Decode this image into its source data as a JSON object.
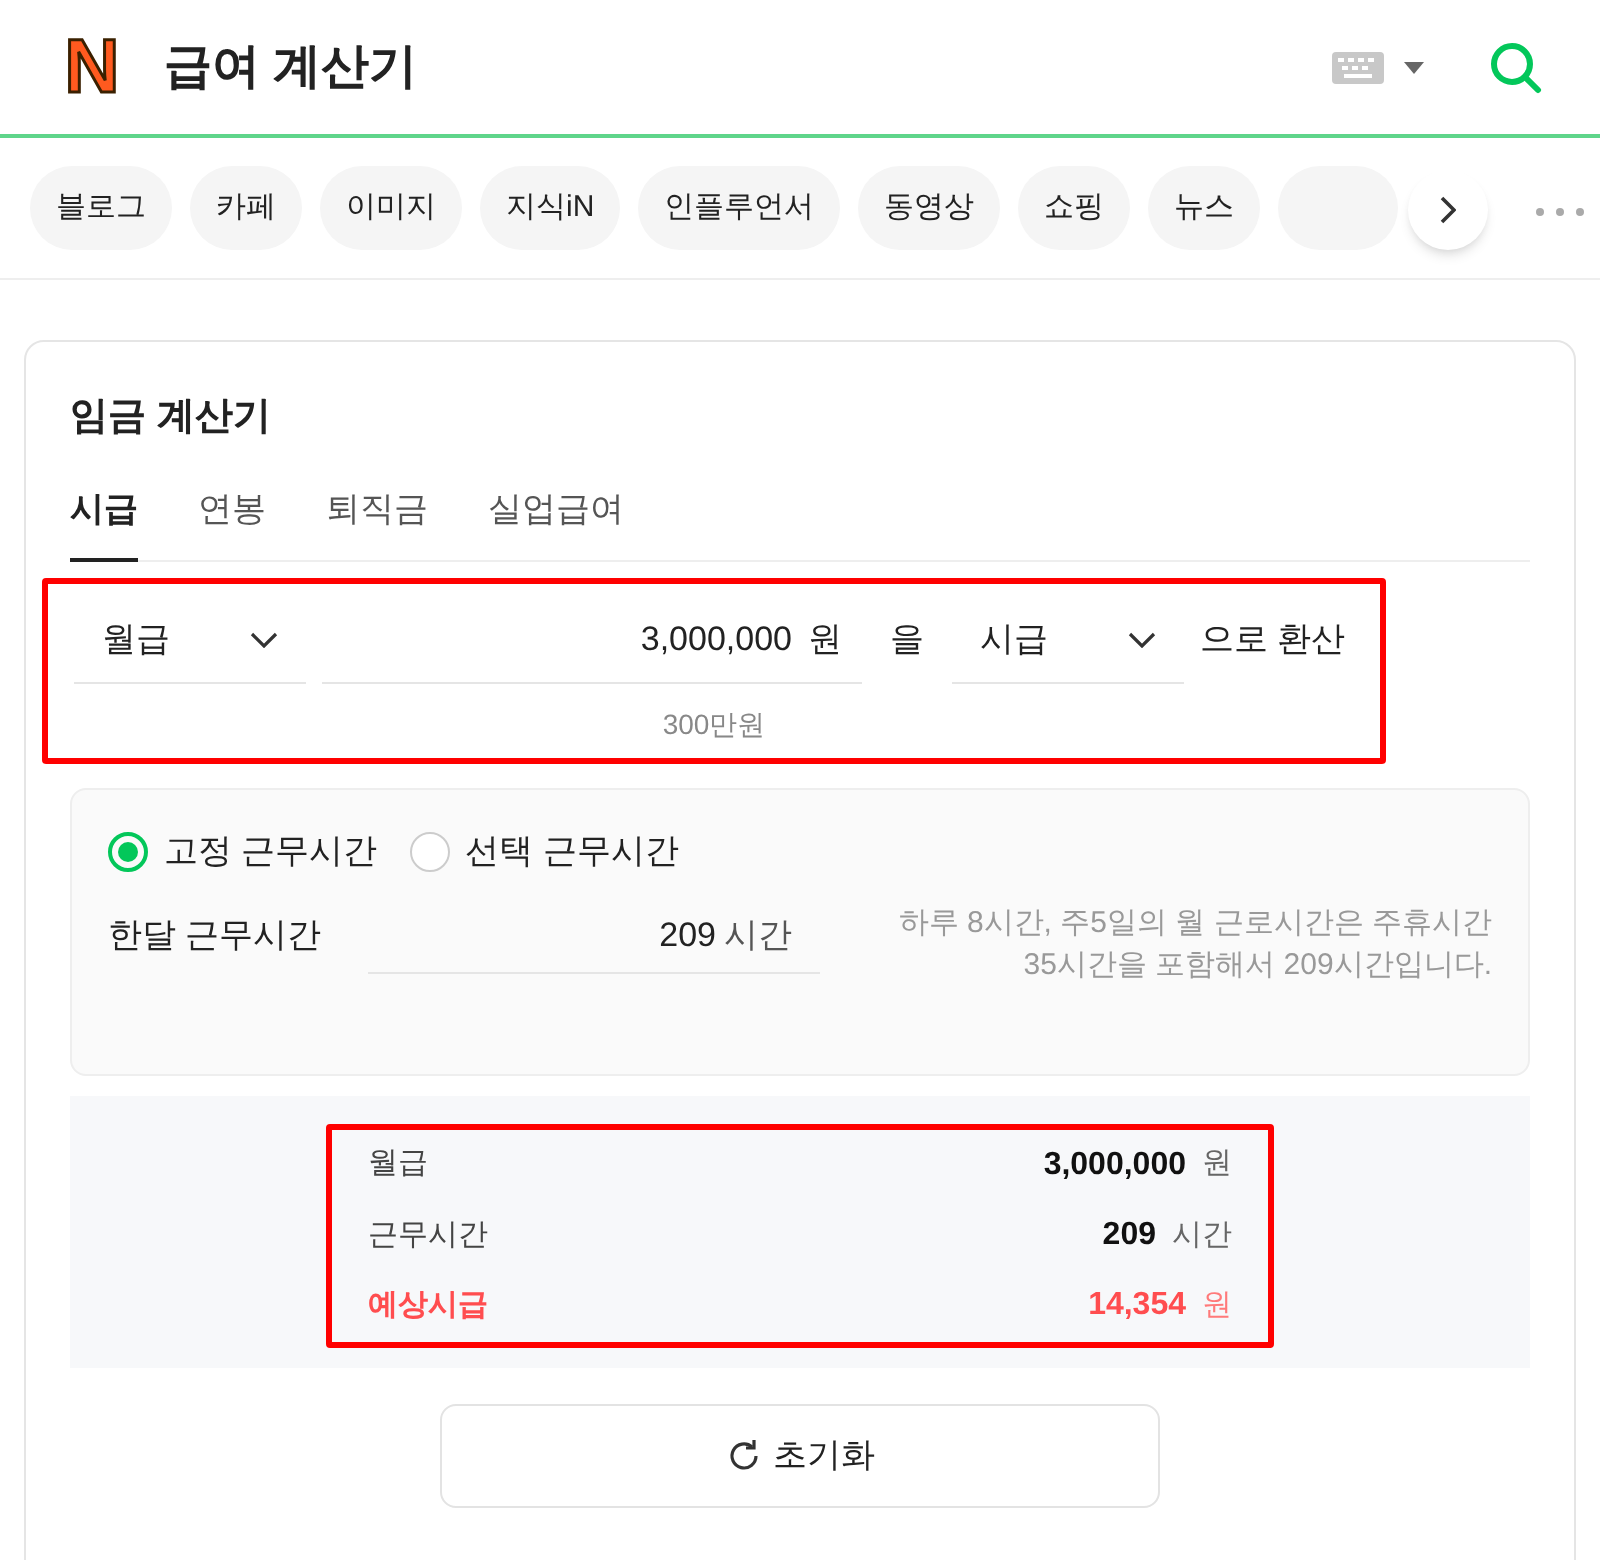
{
  "header": {
    "logo": "N",
    "title": "급여 계산기"
  },
  "chips": [
    "블로그",
    "카페",
    "이미지",
    "지식iN",
    "인플루언서",
    "동영상",
    "쇼핑",
    "뉴스"
  ],
  "calculator": {
    "title": "임금 계산기",
    "tabs": [
      {
        "label": "시급",
        "selected": true
      },
      {
        "label": "연봉",
        "selected": false
      },
      {
        "label": "퇴직금",
        "selected": false
      },
      {
        "label": "실업급여",
        "selected": false
      }
    ],
    "conversion": {
      "highlighted": true,
      "from_unit": "월급",
      "amount": "3,000,000",
      "currency": "원",
      "particle": "을",
      "to_unit": "시급",
      "suffix": "으로 환산",
      "amount_hint": "300만원"
    },
    "work_hours": {
      "options": [
        {
          "label": "고정 근무시간",
          "selected": true
        },
        {
          "label": "선택 근무시간",
          "selected": false
        }
      ],
      "label": "한달 근무시간",
      "value": "209",
      "unit": "시간",
      "note": "하루 8시간, 주5일의 월 근로시간은 주휴시간 35시간을 포함해서 209시간입니다."
    },
    "results": {
      "highlighted": true,
      "rows": [
        {
          "label": "월급",
          "value": "3,000,000",
          "unit": "원",
          "emphasis": false
        },
        {
          "label": "근무시간",
          "value": "209",
          "unit": "시간",
          "emphasis": false
        },
        {
          "label": "예상시급",
          "value": "14,354",
          "unit": "원",
          "emphasis": true
        }
      ]
    },
    "reset_button": "초기화"
  }
}
